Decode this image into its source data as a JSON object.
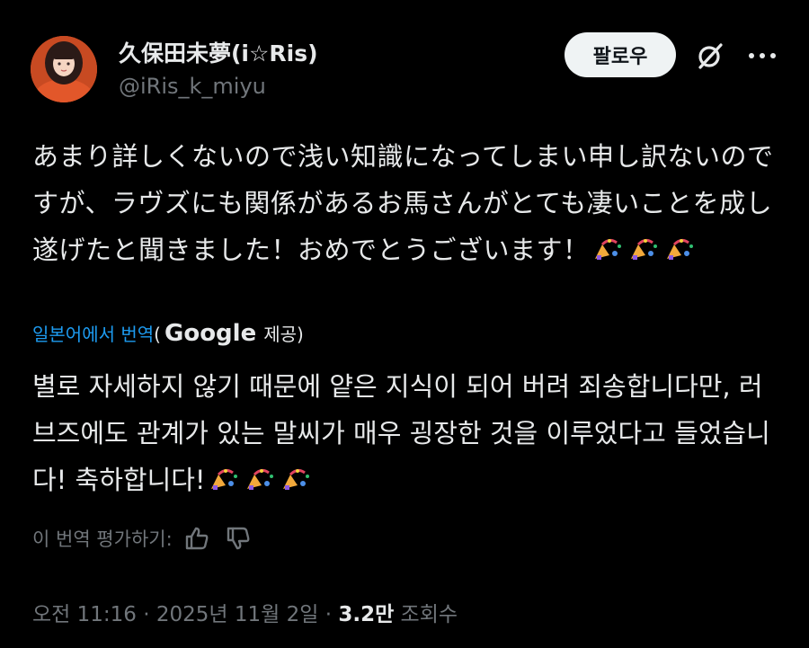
{
  "user": {
    "display_name": "久保田未夢(i☆Ris)",
    "handle": "@iRis_k_miyu"
  },
  "header": {
    "follow_label": "팔로우",
    "icons": [
      "grok-icon",
      "more-icon"
    ]
  },
  "tweet": {
    "original_text": "あまり詳しくないので浅い知識になってしまい申し訳ないのですが、ラヴズにも関係があるお馬さんがとても凄いことを成し遂げたと聞きました！おめでとうございます！",
    "translated_text": "별로 자세하지 않기 때문에 얕은 지식이 되어 버려 죄송합니다만, 러브즈에도 관계가 있는 말씨가 매우 굉장한 것을 이루었다고 들었습니다! 축하합니다!"
  },
  "translation": {
    "link_label": "일본어에서 번역",
    "open_paren": "(",
    "provider": "Google",
    "provided_label": "제공)",
    "rate_label": "이 번역 평가하기:"
  },
  "meta": {
    "time": "오전 11:16",
    "sep1": " · ",
    "date": "2025년 11월 2일",
    "sep2": " · ",
    "views_count": "3.2만",
    "views_label": " 조회수"
  },
  "colors": {
    "background": "#000000",
    "text": "#e7e9ea",
    "muted": "#71767b",
    "link": "#1d9bf0",
    "follow_bg": "#eff3f4"
  }
}
